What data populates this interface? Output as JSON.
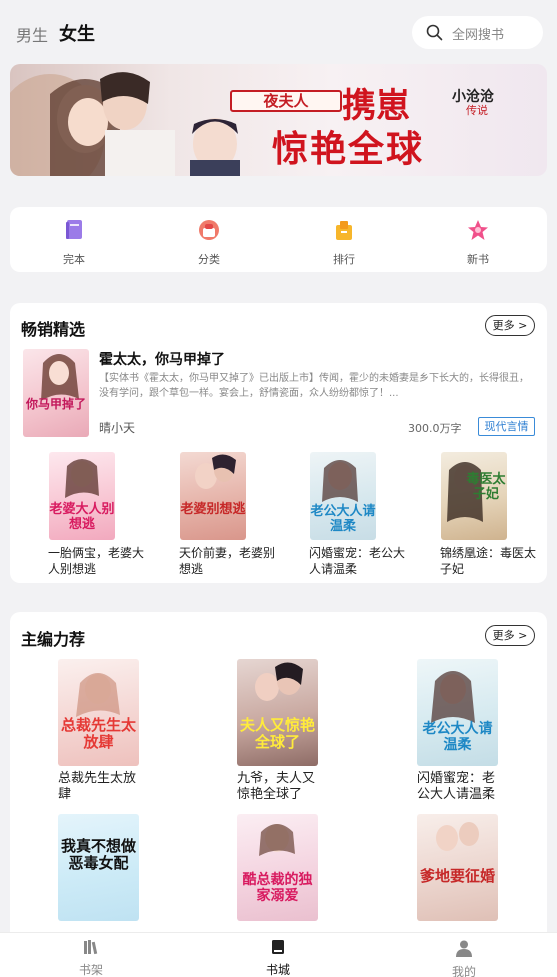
{
  "header": {
    "tab_male": "男生",
    "tab_female": "女生",
    "search_placeholder": "全网搜书",
    "search_icon": "search-icon"
  },
  "banner": {
    "title_small": "夜夫人",
    "title_big": "携崽",
    "title_big2": "惊艳全球",
    "author": "小沧沧",
    "author_suffix": "传说"
  },
  "quick_nav": [
    {
      "label": "完本",
      "icon": "book-complete-icon",
      "color": "#9b7be8"
    },
    {
      "label": "分类",
      "icon": "category-icon",
      "color": "#ee5b5b"
    },
    {
      "label": "排行",
      "icon": "rank-icon",
      "color": "#f5b52a"
    },
    {
      "label": "新书",
      "icon": "new-book-star-icon",
      "color": "#f0508a"
    }
  ],
  "bestsellers": {
    "title": "畅销精选",
    "more": "更多 >",
    "featured": {
      "title": "霍太太，你马甲掉了",
      "desc": "【实体书《霍太太，你马甲又掉了》已出版上市】传闻，霍少的未婚妻是乡下长大的，长得很丑，没有学问，跟个草包一样。宴会上，舒情瓷面，众人纷纷都惊了！...",
      "author": "晴小天",
      "words": "300.0万字",
      "tag": "现代言情",
      "cover_text": "你马甲掉了"
    },
    "books": [
      {
        "title": "一胎俩宝，老婆大人别想逃",
        "cover_text": "老婆大人别想逃"
      },
      {
        "title": "天价前妻，老婆别想逃",
        "cover_text": "老婆别想逃"
      },
      {
        "title": "闪婚蜜宠：老公大人请温柔",
        "cover_text": "老公大人请温柔"
      },
      {
        "title": "锦绣凰途：毒医太子妃",
        "cover_text": "毒医太子妃"
      }
    ]
  },
  "editor_picks": {
    "title": "主编力荐",
    "more": "更多 >",
    "books": [
      {
        "title": "总裁先生太放肆",
        "cover_text": "总裁先生太放肆"
      },
      {
        "title": "九爷，夫人又惊艳全球了",
        "cover_text": "夫人又惊艳全球了"
      },
      {
        "title": "闪婚蜜宠：老公大人请温柔",
        "cover_text": "老公大人请温柔"
      },
      {
        "title": "",
        "cover_text": "我真不想做恶毒女配"
      },
      {
        "title": "",
        "cover_text": "酷总裁的独家溺爱"
      },
      {
        "title": "",
        "cover_text": "爹地要征婚"
      }
    ]
  },
  "tabbar": [
    {
      "label": "书架",
      "icon": "bookshelf-icon"
    },
    {
      "label": "书城",
      "icon": "bookstore-icon",
      "active": true
    },
    {
      "label": "我的",
      "icon": "profile-icon"
    }
  ]
}
